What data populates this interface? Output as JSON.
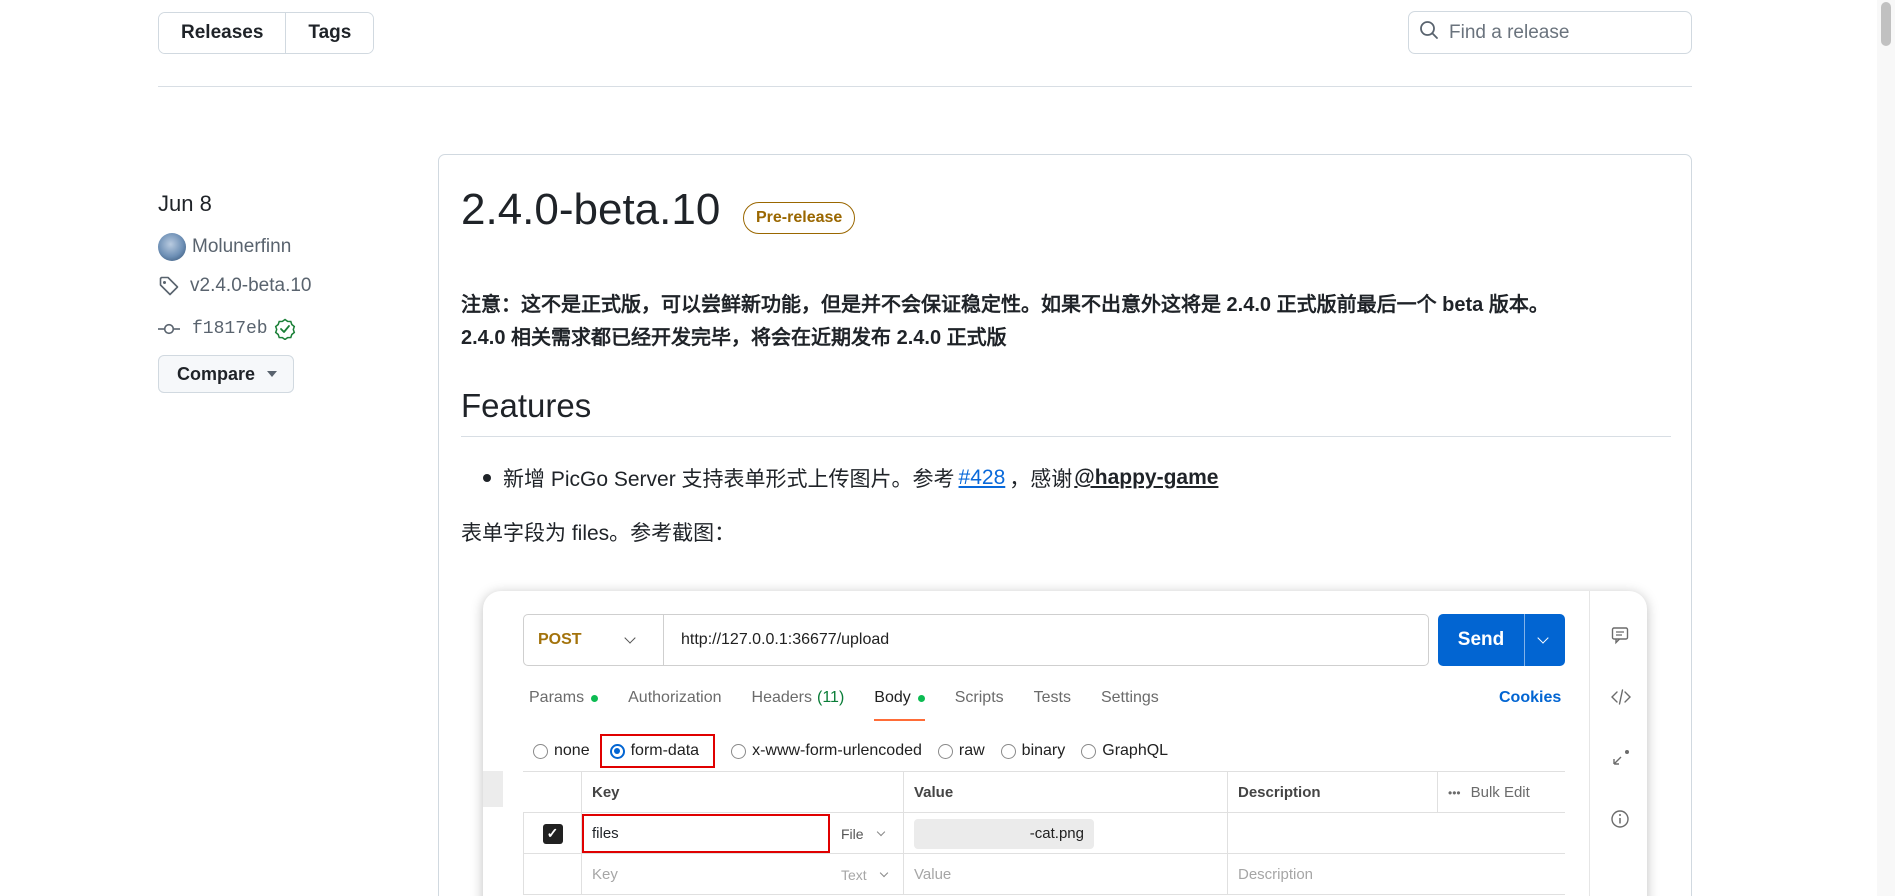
{
  "topbar": {
    "tabs": [
      "Releases",
      "Tags"
    ],
    "search_placeholder": "Find a release"
  },
  "meta": {
    "date": "Jun 8",
    "author": "Molunerfinn",
    "tag": "v2.4.0-beta.10",
    "commit": "f1817eb",
    "compare_label": "Compare"
  },
  "release": {
    "title": "2.4.0-beta.10",
    "badge": "Pre-release",
    "notice_line1": "注意：这不是正式版，可以尝鲜新功能，但是并不会保证稳定性。如果不出意外这将是 2.4.0 正式版前最后一个 beta 版本。",
    "notice_line2": "2.4.0 相关需求都已经开发完毕，将会在近期发布 2.4.0 正式版",
    "features_heading": "Features",
    "bullet_text": "新增 PicGo Server 支持表单形式上传图片。参考",
    "bullet_link": "#428",
    "bullet_mid": "，感谢",
    "bullet_mention": "@happy-game",
    "para2": "表单字段为 files。参考截图："
  },
  "screenshot": {
    "method": "POST",
    "url": "http://127.0.0.1:36677/upload",
    "send_label": "Send",
    "tabs": [
      {
        "label": "Params",
        "dot": true
      },
      {
        "label": "Authorization"
      },
      {
        "label": "Headers",
        "count": "(11)"
      },
      {
        "label": "Body",
        "dot": true,
        "active": true
      },
      {
        "label": "Scripts"
      },
      {
        "label": "Tests"
      },
      {
        "label": "Settings"
      }
    ],
    "cookies_label": "Cookies",
    "body_types": [
      "none",
      "form-data",
      "x-www-form-urlencoded",
      "raw",
      "binary",
      "GraphQL"
    ],
    "selected_body_type": "form-data",
    "table_headers": {
      "key": "Key",
      "value": "Value",
      "description": "Description",
      "bulk_edit": "Bulk Edit"
    },
    "row1": {
      "key": "files",
      "type": "File",
      "value": "-cat.png"
    },
    "row2": {
      "key_placeholder": "Key",
      "type": "Text",
      "value_placeholder": "Value",
      "description_placeholder": "Description"
    }
  }
}
